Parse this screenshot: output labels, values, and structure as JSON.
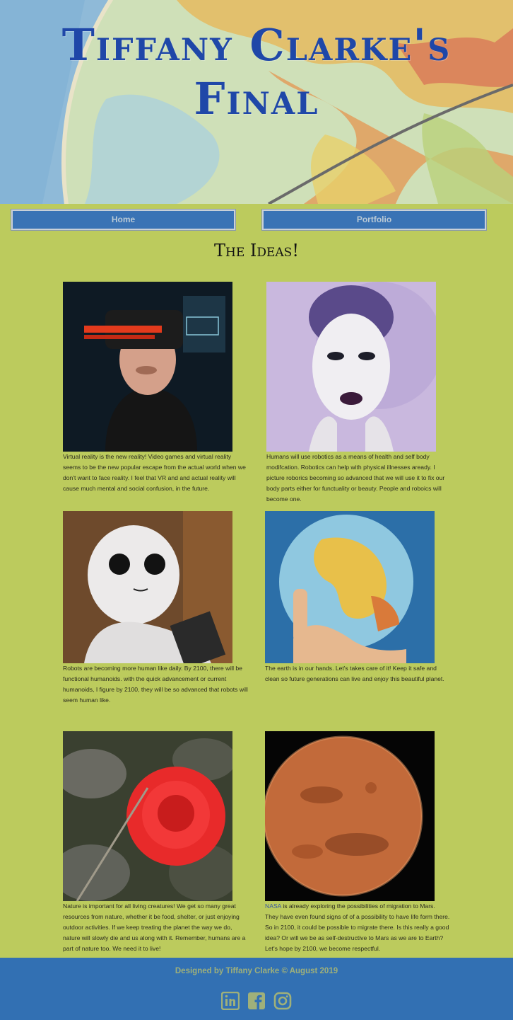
{
  "header": {
    "title": "Tiffany Clarke's Final"
  },
  "nav": {
    "home": "Home",
    "portfolio": "Portfolio"
  },
  "section": {
    "title": "The Ideas!"
  },
  "cards": [
    {
      "image": "vr-headset-photo",
      "caption": "Virtual reality is the new reality! Video games and virtual reality seems to be the new popular escape from the actual world when we don't want to face reality. I feel that VR and and actual reality will cause much mental and social confusion, in the future."
    },
    {
      "image": "robot-woman-photo",
      "caption": "Humans will use robotics as a means of health and self body modifcation. Robotics can help with physical illnesses aready. I picture roborics becoming so advanced that we will use it to fix our body parts either for functuality or beauty. People and roboics will become one."
    },
    {
      "image": "humanoid-robot-photo",
      "caption": "Robots are becoming more human like daily. By 2100, there will be functional humanoids. with the quick advancement or current humanoids, I figure by 2100, they will be so advanced that robots will seem human like."
    },
    {
      "image": "globe-in-hand-photo",
      "caption": "The earth is in our hands. Let's takes care of it! Keep it safe and clean so future generations can live and enjoy this beautiful planet."
    },
    {
      "image": "red-flower-photo",
      "caption": "Nature is important for all living creatures! We get so many great resources from nature, whether it be food, shelter, or just enjoying outdoor activities. If we keep treating the planet the way we do, nature will slowly die and us along with it. Remember, humans are a part of nature too. We need it to live!"
    },
    {
      "image": "mars-photo",
      "caption_link": "NASA",
      "caption": " is already exploring the possibilities of migration to Mars. They have even found signs of of a possibility to have life form there. So in 2100, it could be possible to migrate there. Is this really a good idea? Or will we be as self-destructive to Mars as we are to Earth? Let's hope by 2100, we become respectful."
    }
  ],
  "footer": {
    "text": "Designed by Tiffany Clarke © August 2019",
    "icons": [
      "linkedin-icon",
      "facebook-icon",
      "instagram-icon"
    ]
  },
  "colors": {
    "page": "#bccb5d",
    "accent": "#3270b3",
    "title": "#1f47a8"
  }
}
